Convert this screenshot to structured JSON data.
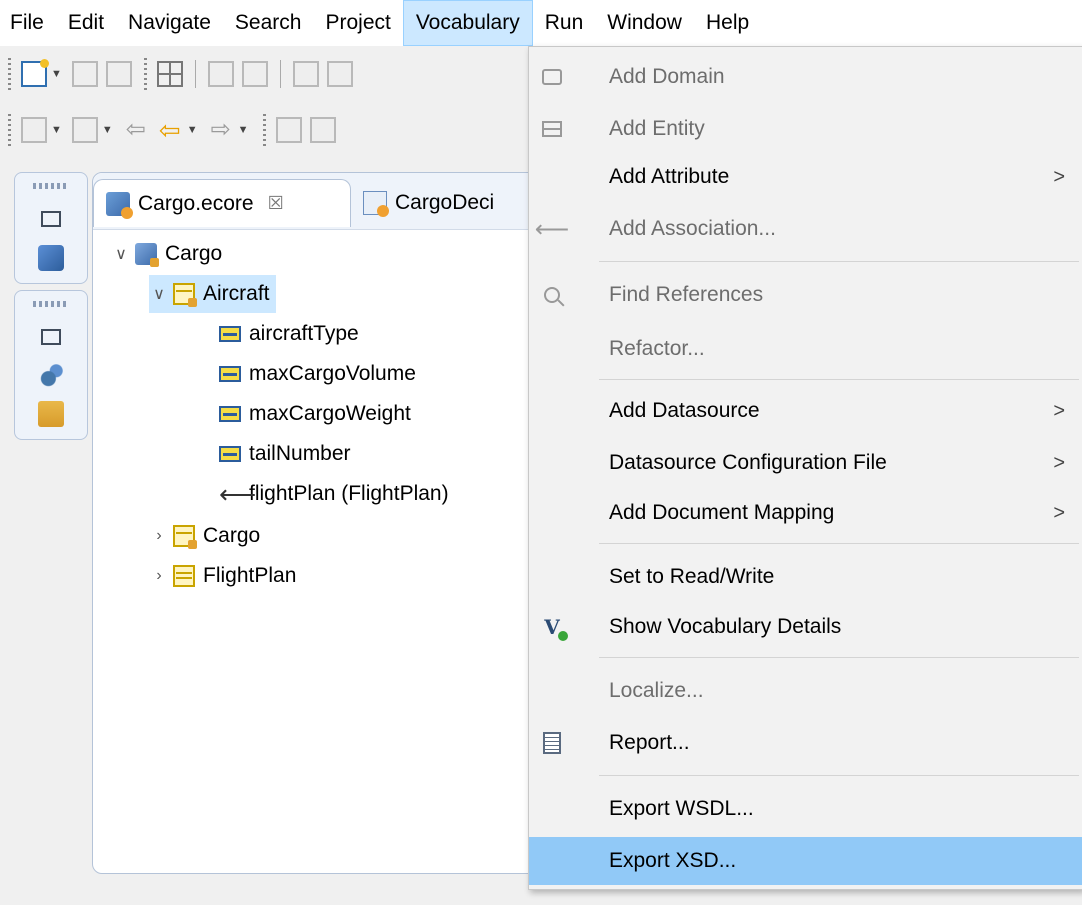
{
  "menubar": {
    "items": [
      {
        "label": "File"
      },
      {
        "label": "Edit"
      },
      {
        "label": "Navigate"
      },
      {
        "label": "Search"
      },
      {
        "label": "Project"
      },
      {
        "label": "Vocabulary"
      },
      {
        "label": "Run"
      },
      {
        "label": "Window"
      },
      {
        "label": "Help"
      }
    ],
    "active": "Vocabulary"
  },
  "editor": {
    "tabs": [
      {
        "label": "Cargo.ecore",
        "icon": "ecore-icon",
        "close": "☒"
      },
      {
        "label": "CargoDeci",
        "icon": "decision-icon"
      }
    ],
    "tree": [
      {
        "label": "Cargo",
        "icon": "package-icon",
        "expanded": true
      },
      {
        "label": "Aircraft",
        "icon": "class-icon",
        "expanded": true,
        "selected": true
      },
      {
        "label": "aircraftType",
        "icon": "attribute-icon"
      },
      {
        "label": "maxCargoVolume",
        "icon": "attribute-icon"
      },
      {
        "label": "maxCargoWeight",
        "icon": "attribute-icon"
      },
      {
        "label": "tailNumber",
        "icon": "attribute-icon"
      },
      {
        "label": "flightPlan (FlightPlan)",
        "icon": "association-icon"
      },
      {
        "label": "Cargo",
        "icon": "class-icon",
        "expanded": false
      },
      {
        "label": "FlightPlan",
        "icon": "class-icon",
        "expanded": false
      }
    ]
  },
  "vocabulary_menu": {
    "items": [
      {
        "label": "Add Domain",
        "icon": "domain-icon",
        "enabled": false
      },
      {
        "label": "Add Entity",
        "icon": "entity-icon",
        "enabled": false
      },
      {
        "label": "Add Attribute",
        "enabled": true,
        "submenu": true
      },
      {
        "label": "Add Association...",
        "icon": "association-icon",
        "enabled": false
      },
      {
        "label": "Find References",
        "icon": "find-icon",
        "enabled": false
      },
      {
        "label": "Refactor...",
        "enabled": false
      },
      {
        "label": "Add Datasource",
        "enabled": true,
        "submenu": true
      },
      {
        "label": "Datasource Configuration File",
        "enabled": true,
        "submenu": true
      },
      {
        "label": "Add Document Mapping",
        "enabled": true,
        "submenu": true
      },
      {
        "label": "Set to Read/Write",
        "enabled": true
      },
      {
        "label": "Show Vocabulary Details",
        "icon": "vocabulary-details-icon",
        "enabled": true
      },
      {
        "label": "Localize...",
        "enabled": false
      },
      {
        "label": "Report...",
        "icon": "report-icon",
        "enabled": true
      },
      {
        "label": "Export WSDL...",
        "enabled": true
      },
      {
        "label": "Export XSD...",
        "enabled": true,
        "highlighted": true
      }
    ],
    "submenu_glyph": ">",
    "vocab_icon_glyph": "V"
  },
  "colors": {
    "menu_highlight": "#91c9f7",
    "menubar_active": "#cce8ff",
    "tree_selection": "#cce8ff"
  }
}
